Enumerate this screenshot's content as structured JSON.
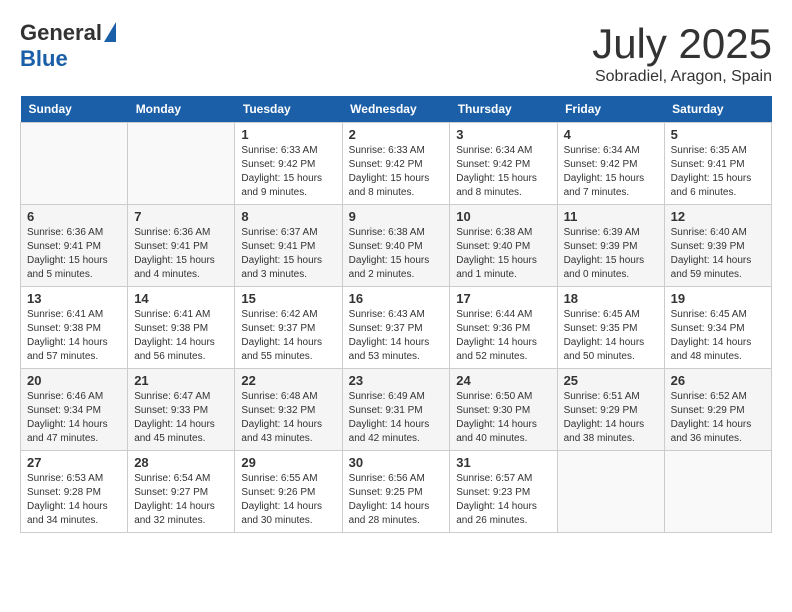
{
  "header": {
    "logo_general": "General",
    "logo_blue": "Blue",
    "month_title": "July 2025",
    "location": "Sobradiel, Aragon, Spain"
  },
  "days_of_week": [
    "Sunday",
    "Monday",
    "Tuesday",
    "Wednesday",
    "Thursday",
    "Friday",
    "Saturday"
  ],
  "weeks": [
    [
      {
        "day": "",
        "sunrise": "",
        "sunset": "",
        "daylight": ""
      },
      {
        "day": "",
        "sunrise": "",
        "sunset": "",
        "daylight": ""
      },
      {
        "day": "1",
        "sunrise": "Sunrise: 6:33 AM",
        "sunset": "Sunset: 9:42 PM",
        "daylight": "Daylight: 15 hours and 9 minutes."
      },
      {
        "day": "2",
        "sunrise": "Sunrise: 6:33 AM",
        "sunset": "Sunset: 9:42 PM",
        "daylight": "Daylight: 15 hours and 8 minutes."
      },
      {
        "day": "3",
        "sunrise": "Sunrise: 6:34 AM",
        "sunset": "Sunset: 9:42 PM",
        "daylight": "Daylight: 15 hours and 8 minutes."
      },
      {
        "day": "4",
        "sunrise": "Sunrise: 6:34 AM",
        "sunset": "Sunset: 9:42 PM",
        "daylight": "Daylight: 15 hours and 7 minutes."
      },
      {
        "day": "5",
        "sunrise": "Sunrise: 6:35 AM",
        "sunset": "Sunset: 9:41 PM",
        "daylight": "Daylight: 15 hours and 6 minutes."
      }
    ],
    [
      {
        "day": "6",
        "sunrise": "Sunrise: 6:36 AM",
        "sunset": "Sunset: 9:41 PM",
        "daylight": "Daylight: 15 hours and 5 minutes."
      },
      {
        "day": "7",
        "sunrise": "Sunrise: 6:36 AM",
        "sunset": "Sunset: 9:41 PM",
        "daylight": "Daylight: 15 hours and 4 minutes."
      },
      {
        "day": "8",
        "sunrise": "Sunrise: 6:37 AM",
        "sunset": "Sunset: 9:41 PM",
        "daylight": "Daylight: 15 hours and 3 minutes."
      },
      {
        "day": "9",
        "sunrise": "Sunrise: 6:38 AM",
        "sunset": "Sunset: 9:40 PM",
        "daylight": "Daylight: 15 hours and 2 minutes."
      },
      {
        "day": "10",
        "sunrise": "Sunrise: 6:38 AM",
        "sunset": "Sunset: 9:40 PM",
        "daylight": "Daylight: 15 hours and 1 minute."
      },
      {
        "day": "11",
        "sunrise": "Sunrise: 6:39 AM",
        "sunset": "Sunset: 9:39 PM",
        "daylight": "Daylight: 15 hours and 0 minutes."
      },
      {
        "day": "12",
        "sunrise": "Sunrise: 6:40 AM",
        "sunset": "Sunset: 9:39 PM",
        "daylight": "Daylight: 14 hours and 59 minutes."
      }
    ],
    [
      {
        "day": "13",
        "sunrise": "Sunrise: 6:41 AM",
        "sunset": "Sunset: 9:38 PM",
        "daylight": "Daylight: 14 hours and 57 minutes."
      },
      {
        "day": "14",
        "sunrise": "Sunrise: 6:41 AM",
        "sunset": "Sunset: 9:38 PM",
        "daylight": "Daylight: 14 hours and 56 minutes."
      },
      {
        "day": "15",
        "sunrise": "Sunrise: 6:42 AM",
        "sunset": "Sunset: 9:37 PM",
        "daylight": "Daylight: 14 hours and 55 minutes."
      },
      {
        "day": "16",
        "sunrise": "Sunrise: 6:43 AM",
        "sunset": "Sunset: 9:37 PM",
        "daylight": "Daylight: 14 hours and 53 minutes."
      },
      {
        "day": "17",
        "sunrise": "Sunrise: 6:44 AM",
        "sunset": "Sunset: 9:36 PM",
        "daylight": "Daylight: 14 hours and 52 minutes."
      },
      {
        "day": "18",
        "sunrise": "Sunrise: 6:45 AM",
        "sunset": "Sunset: 9:35 PM",
        "daylight": "Daylight: 14 hours and 50 minutes."
      },
      {
        "day": "19",
        "sunrise": "Sunrise: 6:45 AM",
        "sunset": "Sunset: 9:34 PM",
        "daylight": "Daylight: 14 hours and 48 minutes."
      }
    ],
    [
      {
        "day": "20",
        "sunrise": "Sunrise: 6:46 AM",
        "sunset": "Sunset: 9:34 PM",
        "daylight": "Daylight: 14 hours and 47 minutes."
      },
      {
        "day": "21",
        "sunrise": "Sunrise: 6:47 AM",
        "sunset": "Sunset: 9:33 PM",
        "daylight": "Daylight: 14 hours and 45 minutes."
      },
      {
        "day": "22",
        "sunrise": "Sunrise: 6:48 AM",
        "sunset": "Sunset: 9:32 PM",
        "daylight": "Daylight: 14 hours and 43 minutes."
      },
      {
        "day": "23",
        "sunrise": "Sunrise: 6:49 AM",
        "sunset": "Sunset: 9:31 PM",
        "daylight": "Daylight: 14 hours and 42 minutes."
      },
      {
        "day": "24",
        "sunrise": "Sunrise: 6:50 AM",
        "sunset": "Sunset: 9:30 PM",
        "daylight": "Daylight: 14 hours and 40 minutes."
      },
      {
        "day": "25",
        "sunrise": "Sunrise: 6:51 AM",
        "sunset": "Sunset: 9:29 PM",
        "daylight": "Daylight: 14 hours and 38 minutes."
      },
      {
        "day": "26",
        "sunrise": "Sunrise: 6:52 AM",
        "sunset": "Sunset: 9:29 PM",
        "daylight": "Daylight: 14 hours and 36 minutes."
      }
    ],
    [
      {
        "day": "27",
        "sunrise": "Sunrise: 6:53 AM",
        "sunset": "Sunset: 9:28 PM",
        "daylight": "Daylight: 14 hours and 34 minutes."
      },
      {
        "day": "28",
        "sunrise": "Sunrise: 6:54 AM",
        "sunset": "Sunset: 9:27 PM",
        "daylight": "Daylight: 14 hours and 32 minutes."
      },
      {
        "day": "29",
        "sunrise": "Sunrise: 6:55 AM",
        "sunset": "Sunset: 9:26 PM",
        "daylight": "Daylight: 14 hours and 30 minutes."
      },
      {
        "day": "30",
        "sunrise": "Sunrise: 6:56 AM",
        "sunset": "Sunset: 9:25 PM",
        "daylight": "Daylight: 14 hours and 28 minutes."
      },
      {
        "day": "31",
        "sunrise": "Sunrise: 6:57 AM",
        "sunset": "Sunset: 9:23 PM",
        "daylight": "Daylight: 14 hours and 26 minutes."
      },
      {
        "day": "",
        "sunrise": "",
        "sunset": "",
        "daylight": ""
      },
      {
        "day": "",
        "sunrise": "",
        "sunset": "",
        "daylight": ""
      }
    ]
  ]
}
